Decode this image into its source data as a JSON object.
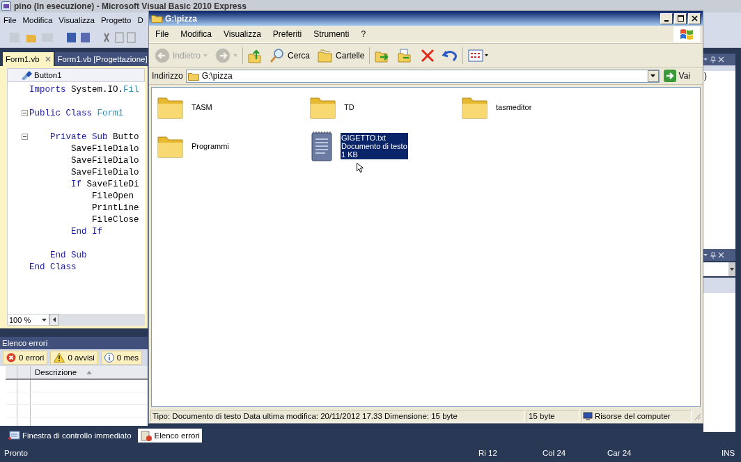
{
  "ide": {
    "title": "pino (In esecuzione) - Microsoft Visual Basic 2010 Express",
    "menu": [
      "File",
      "Modifica",
      "Visualizza",
      "Progetto",
      "D"
    ],
    "doc_tabs": [
      {
        "label": "Form1.vb",
        "selected": true
      },
      {
        "label": "Form1.vb [Progettazione]",
        "selected": false
      }
    ],
    "member_dropdown": "Button1",
    "code_lines": [
      {
        "kind": "text",
        "tokens": [
          {
            "text": "Imports ",
            "kind": "keyword"
          },
          {
            "text": "System.IO.",
            "kind": "plain"
          },
          {
            "text": "Fil",
            "kind": "type"
          }
        ]
      },
      {
        "kind": "blank"
      },
      {
        "kind": "fold",
        "tokens": [
          {
            "text": "Public Class ",
            "kind": "keyword"
          },
          {
            "text": "Form1",
            "kind": "type"
          }
        ]
      },
      {
        "kind": "blank"
      },
      {
        "kind": "fold",
        "tokens": [
          {
            "text": "    Private Sub ",
            "kind": "keyword"
          },
          {
            "text": "Butto",
            "kind": "plain"
          }
        ]
      },
      {
        "kind": "text",
        "tokens": [
          {
            "text": "        SaveFileDialo",
            "kind": "plain"
          }
        ]
      },
      {
        "kind": "text",
        "tokens": [
          {
            "text": "        SaveFileDialo",
            "kind": "plain"
          }
        ]
      },
      {
        "kind": "text",
        "tokens": [
          {
            "text": "        SaveFileDialo",
            "kind": "plain"
          }
        ]
      },
      {
        "kind": "text",
        "tokens": [
          {
            "text": "        If ",
            "kind": "keyword"
          },
          {
            "text": "SaveFileDi",
            "kind": "plain"
          }
        ]
      },
      {
        "kind": "text",
        "tokens": [
          {
            "text": "            FileOpen",
            "kind": "plain"
          }
        ]
      },
      {
        "kind": "text",
        "tokens": [
          {
            "text": "            PrintLine",
            "kind": "plain"
          }
        ]
      },
      {
        "kind": "text",
        "tokens": [
          {
            "text": "            FileClose",
            "kind": "plain"
          }
        ]
      },
      {
        "kind": "text",
        "tokens": [
          {
            "text": "        End If",
            "kind": "keyword"
          }
        ]
      },
      {
        "kind": "blank"
      },
      {
        "kind": "text",
        "tokens": [
          {
            "text": "    End Sub",
            "kind": "keyword"
          }
        ]
      },
      {
        "kind": "text",
        "tokens": [
          {
            "text": "End Class",
            "kind": "keyword"
          }
        ]
      }
    ],
    "zoom": "100 %",
    "error_list": {
      "title": "Elenco errori",
      "filters": [
        {
          "label": "0 errori",
          "kind": "error"
        },
        {
          "label": "0 avvisi",
          "kind": "warning"
        },
        {
          "label": "0 mes",
          "kind": "info"
        }
      ],
      "columns": [
        "Descrizione"
      ]
    },
    "bottom_tabs": [
      {
        "label": "Finestra di controllo immediato",
        "kind": "immediate",
        "selected": false
      },
      {
        "label": "Elenco errori",
        "kind": "errors",
        "selected": true
      }
    ],
    "side_text": ")",
    "status_bar": {
      "message": "Pronto",
      "line": "Ri 12",
      "column": "Col 24",
      "char": "Car 24",
      "mode": "INS"
    }
  },
  "explorer": {
    "title": "G:\\pizza",
    "menu": [
      "File",
      "Modifica",
      "Visualizza",
      "Preferiti",
      "Strumenti",
      "?"
    ],
    "toolbar": [
      {
        "kind": "back",
        "label": "Indietro",
        "disabled": true
      },
      {
        "kind": "forward",
        "disabled": true
      },
      {
        "kind": "up",
        "disabled": false
      },
      {
        "kind": "search",
        "label": "Cerca",
        "disabled": false
      },
      {
        "kind": "folders",
        "label": "Cartelle",
        "disabled": false
      },
      {
        "kind": "move",
        "disabled": false
      },
      {
        "kind": "copy",
        "disabled": false
      },
      {
        "kind": "delete",
        "disabled": false
      },
      {
        "kind": "undo",
        "disabled": false
      },
      {
        "kind": "views",
        "disabled": false
      }
    ],
    "address_label": "Indirizzo",
    "address": "G:\\pizza",
    "go": "Vai",
    "items": [
      {
        "name": "TASM",
        "kind": "folder",
        "selected": false
      },
      {
        "name": "TD",
        "kind": "folder",
        "selected": false
      },
      {
        "name": "tasmeditor",
        "kind": "folder",
        "selected": false
      },
      {
        "name": "Programmi",
        "kind": "folder",
        "selected": false
      },
      {
        "name": "GIGETTO.txt",
        "kind": "text",
        "details": [
          "Documento di testo",
          "1 KB"
        ],
        "selected": true
      }
    ],
    "status": {
      "info": "Tipo: Documento di testo Data ultima modifica: 20/11/2012 17.33 Dimensione: 15 byte",
      "size": "15 byte",
      "zone": "Risorse del computer"
    }
  }
}
